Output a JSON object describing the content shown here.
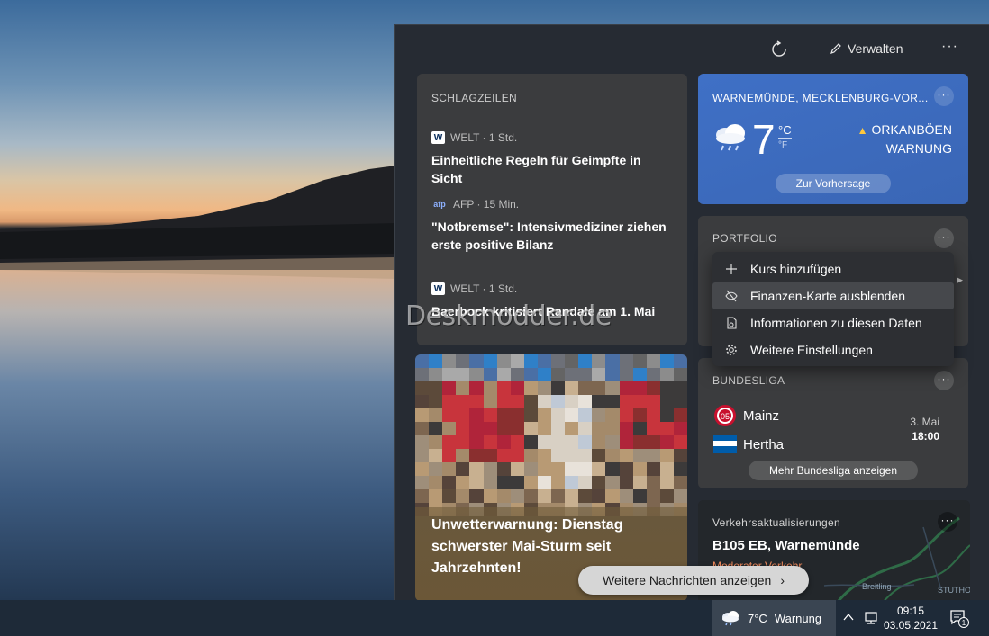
{
  "panel": {
    "header": {
      "manage_label": "Verwalten",
      "more_label": "···"
    },
    "news": {
      "title": "SCHLAGZEILEN",
      "stories": [
        {
          "source": "WELT · 1 Std.",
          "logo": "W",
          "headline": "Einheitliche Regeln für Geimpfte in Sicht"
        },
        {
          "source": "AFP · 15 Min.",
          "logo": "afp",
          "headline": "\"Notbremse\": Intensivmediziner ziehen erste positive Bilanz"
        },
        {
          "source": "WELT · 1 Std.",
          "logo": "W",
          "headline": "Baerbock kritisiert Randale am 1. Mai"
        }
      ]
    },
    "photo_story": {
      "headline": "Unwetterwarnung: Dienstag schwerster Mai-Sturm seit Jahrzehnten!"
    },
    "weather": {
      "location": "WARNEMÜNDE, MECKLENBURG-VOR...",
      "temperature": "7",
      "unit_c": "°C",
      "unit_f": "°F",
      "alert_line1": "ORKANBÖEN",
      "alert_line2": "WARNUNG",
      "forecast_button": "Zur Vorhersage",
      "more": "···"
    },
    "portfolio": {
      "title": "PORTFOLIO",
      "more": "···"
    },
    "context_menu": {
      "items": [
        {
          "label": "Kurs hinzufügen",
          "icon": "plus-icon"
        },
        {
          "label": "Finanzen-Karte ausblenden",
          "icon": "eye-off-icon"
        },
        {
          "label": "Informationen zu diesen Daten",
          "icon": "info-doc-icon"
        },
        {
          "label": "Weitere Einstellungen",
          "icon": "gear-icon"
        }
      ]
    },
    "bundesliga": {
      "title": "BUNDESLIGA",
      "more": "···",
      "home_team": "Mainz",
      "away_team": "Hertha",
      "date": "3. Mai",
      "time": "18:00",
      "more_button": "Mehr Bundesliga anzeigen"
    },
    "traffic": {
      "title": "Verkehrsaktualisierungen",
      "road": "B105 EB, Warnemünde",
      "status": "Moderater Verkehr",
      "map_label_1": "Breitling",
      "map_label_2": "STUTHO",
      "more": "···"
    },
    "more_news_button": "Weitere Nachrichten anzeigen"
  },
  "watermark": "Deskmodder.de",
  "taskbar": {
    "weather_temp": "7°C",
    "weather_status": "Warnung",
    "time": "09:15",
    "date": "03.05.2021",
    "notification_count": "1"
  },
  "colors": {
    "panel_bg": "#262b33",
    "card_bg": "#3b3c3e",
    "weather_card": "#3f70c6",
    "warning": "#ffc83d",
    "traffic_status": "#f08a5d",
    "taskbar_bg": "#1e2a38"
  }
}
